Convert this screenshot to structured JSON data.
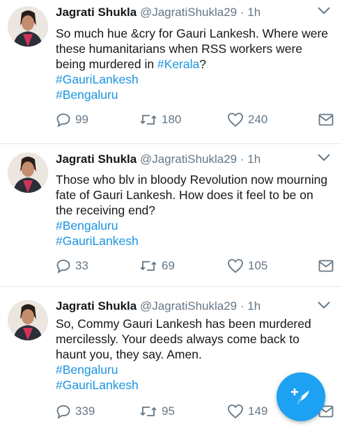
{
  "tweets": [
    {
      "name": "Jagrati Shukla",
      "handle": "@JagratiShukla29",
      "separator": "·",
      "time": "1h",
      "line1": "So much hue &cry for Gauri Lankesh. Where were",
      "line2": "these humanitarians when RSS workers were",
      "line3_prefix": "being murdered in ",
      "line3_link": "#Kerala",
      "line3_suffix": "?",
      "hashtag1": "#GauriLankesh",
      "hashtag2": "#Bengaluru",
      "replies": "99",
      "retweets": "180",
      "likes": "240"
    },
    {
      "name": "Jagrati Shukla",
      "handle": "@JagratiShukla29",
      "separator": "·",
      "time": "1h",
      "line1": "Those who blv in bloody Revolution now mourning",
      "line2": "fate of Gauri Lankesh. How does it feel to be on",
      "line3": "the receiving end?",
      "hashtag1": "#Bengaluru",
      "hashtag2": "#GauriLankesh",
      "replies": "33",
      "retweets": "69",
      "likes": "105"
    },
    {
      "name": "Jagrati Shukla",
      "handle": "@JagratiShukla29",
      "separator": "·",
      "time": "1h",
      "line1": "So, Commy Gauri Lankesh has been murdered",
      "line2": "mercilessly. Your deeds always come back to",
      "line3": "haunt you, they say. Amen.",
      "hashtag1": "#Bengaluru",
      "hashtag2": "#GauriLankesh",
      "replies": "339",
      "retweets": "95",
      "likes": "149"
    }
  ],
  "colors": {
    "link": "#1b95e0",
    "muted": "#657786",
    "fab": "#1da1f2"
  },
  "icons": {
    "reply": "reply-icon",
    "retweet": "retweet-icon",
    "like": "heart-icon",
    "dm": "envelope-icon",
    "menu": "chevron-down-icon",
    "compose": "compose-feather-icon"
  }
}
